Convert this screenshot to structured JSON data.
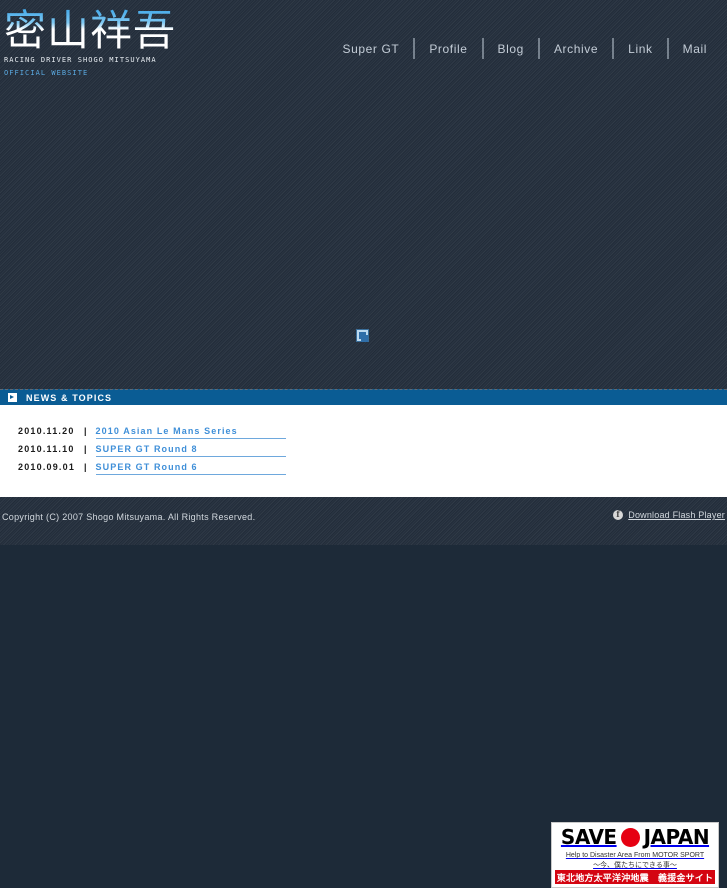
{
  "site": {
    "logo_kanji": "密山祥吾",
    "logo_subtitle": "RACING DRIVER SHOGO MITSUYAMA",
    "logo_tagline": "OFFICIAL WEBSITE"
  },
  "nav": {
    "items": [
      {
        "label": "Super GT"
      },
      {
        "label": "Profile"
      },
      {
        "label": "Blog"
      },
      {
        "label": "Archive"
      },
      {
        "label": "Link"
      },
      {
        "label": "Mail"
      }
    ]
  },
  "stage": {
    "broken_image_icon": "broken-image-icon"
  },
  "news": {
    "bar_icon": "arrow-right-icon",
    "bar_title": "NEWS & TOPICS",
    "items": [
      {
        "date": "2010.11.20",
        "separator": "|",
        "title": "2010 Asian Le Mans Series"
      },
      {
        "date": "2010.11.10",
        "separator": "|",
        "title": "SUPER GT Round 8"
      },
      {
        "date": "2010.09.01",
        "separator": "|",
        "title": "SUPER GT Round 6"
      }
    ]
  },
  "banner": {
    "word_left": "SAVE",
    "word_right": "JAPAN",
    "dot_icon": "japan-flag-circle-icon",
    "line1": "Help to Disaster Area From MOTOR SPORT",
    "line2": "〜今、僕たちにできる事〜",
    "red_bar_text": "東北地方太平洋沖地震　義援金サイト",
    "accent_red": "#d40511"
  },
  "footer": {
    "copyright": "Copyright (C) 2007 Shogo Mitsuyama. All Rights Reserved.",
    "flash_icon": "flash-player-icon",
    "flash_label": "Download Flash Player"
  },
  "theme": {
    "background": "#26313f",
    "news_bar_blue": "#0a5c94",
    "link_blue": "#3f8fd8",
    "logo_accent": "#5aa9e0"
  }
}
